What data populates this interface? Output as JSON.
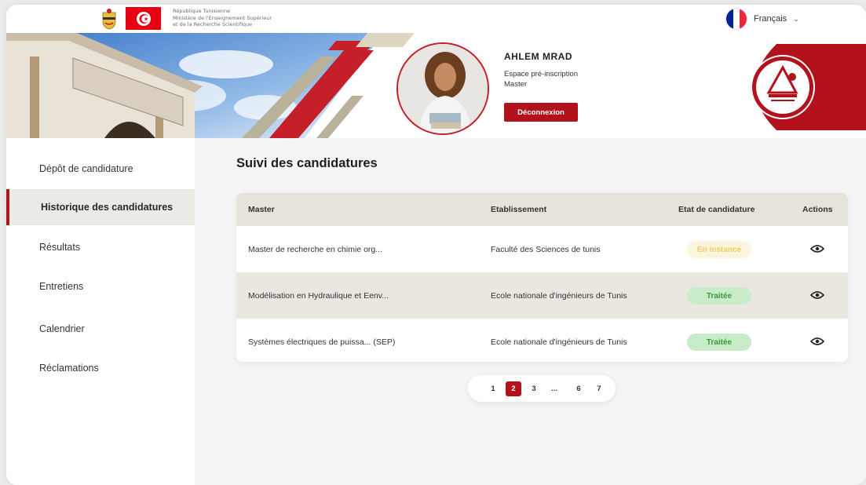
{
  "header": {
    "ministry_lines": [
      "République Tunisienne",
      "Ministère de l'Enseignement Supérieur",
      "et de la Recherche Scientifique"
    ],
    "language": "Français"
  },
  "profile": {
    "name": "AHLEM MRAD",
    "space": "Espace pré-inscription",
    "level": "Master",
    "logout_label": "Déconnexion"
  },
  "sidebar": {
    "items": [
      {
        "label": "Dépôt de candidature"
      },
      {
        "label": "Historique des candidatures"
      },
      {
        "label": "Résultats"
      },
      {
        "label": "Entretiens"
      },
      {
        "label": "Calendrier"
      },
      {
        "label": "Réclamations"
      }
    ],
    "active_index": 1
  },
  "main": {
    "title": "Suivi des candidatures",
    "columns": [
      "Master",
      "Etablissement",
      "Etat de candidature",
      "Actions"
    ],
    "rows": [
      {
        "master": "Master de recherche en chimie org...",
        "etablissement": "Faculté des Sciences de tunis",
        "etat": "En instance"
      },
      {
        "master": "Modélisation en Hydraulique et Eenv...",
        "etablissement": "Ecole nationale d'ingénieurs de Tunis",
        "etat": "Traitée"
      },
      {
        "master": "Systèmes électriques de puissa... (SEP)",
        "etablissement": "Ecole nationale d'ingénieurs de Tunis",
        "etat": "Traitée"
      }
    ]
  },
  "pagination": {
    "pages": [
      "1",
      "2",
      "3",
      "...",
      "6",
      "7"
    ],
    "current": "2"
  },
  "colors": {
    "accent": "#b3111c",
    "pending_text": "#f4cd5d",
    "done_text": "#3b9a3b"
  },
  "icons": [
    "tunisia-emblem-icon",
    "tunisia-flag-icon",
    "france-flag-icon",
    "chevron-down-icon",
    "eye-icon",
    "university-logo"
  ]
}
